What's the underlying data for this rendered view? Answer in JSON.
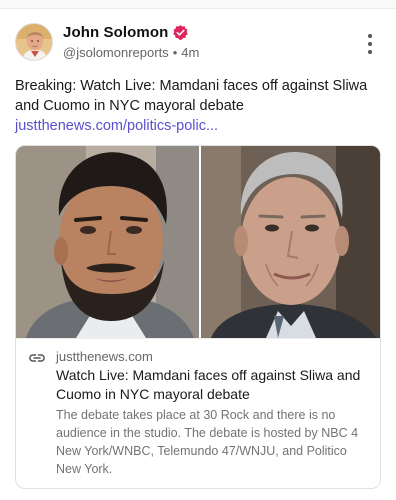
{
  "post": {
    "author": {
      "name": "John Solomon",
      "handle": "@jsolomonreports",
      "separator": "•",
      "time": "4m",
      "verified": true
    },
    "text": "Breaking: Watch Live: Mamdani faces off against Sliwa and Cuomo in NYC mayoral debate ",
    "link_text": "justthenews.com/politics-polic...",
    "accent_color": "#5a4fcf",
    "verified_color": "#e0245e"
  },
  "card": {
    "domain": "justthenews.com",
    "title": "Watch Live: Mamdani faces off against Sliwa and Cuomo in NYC mayoral debate",
    "description": "The debate takes place at 30 Rock and there is no audience in the studio. The debate is hosted by NBC 4 New York/WNBC, Telemundo 47/WNJU, and Politico New York."
  },
  "icons": {
    "more": "more-vertical-icon",
    "verified": "verified-badge-icon",
    "link": "link-icon"
  }
}
